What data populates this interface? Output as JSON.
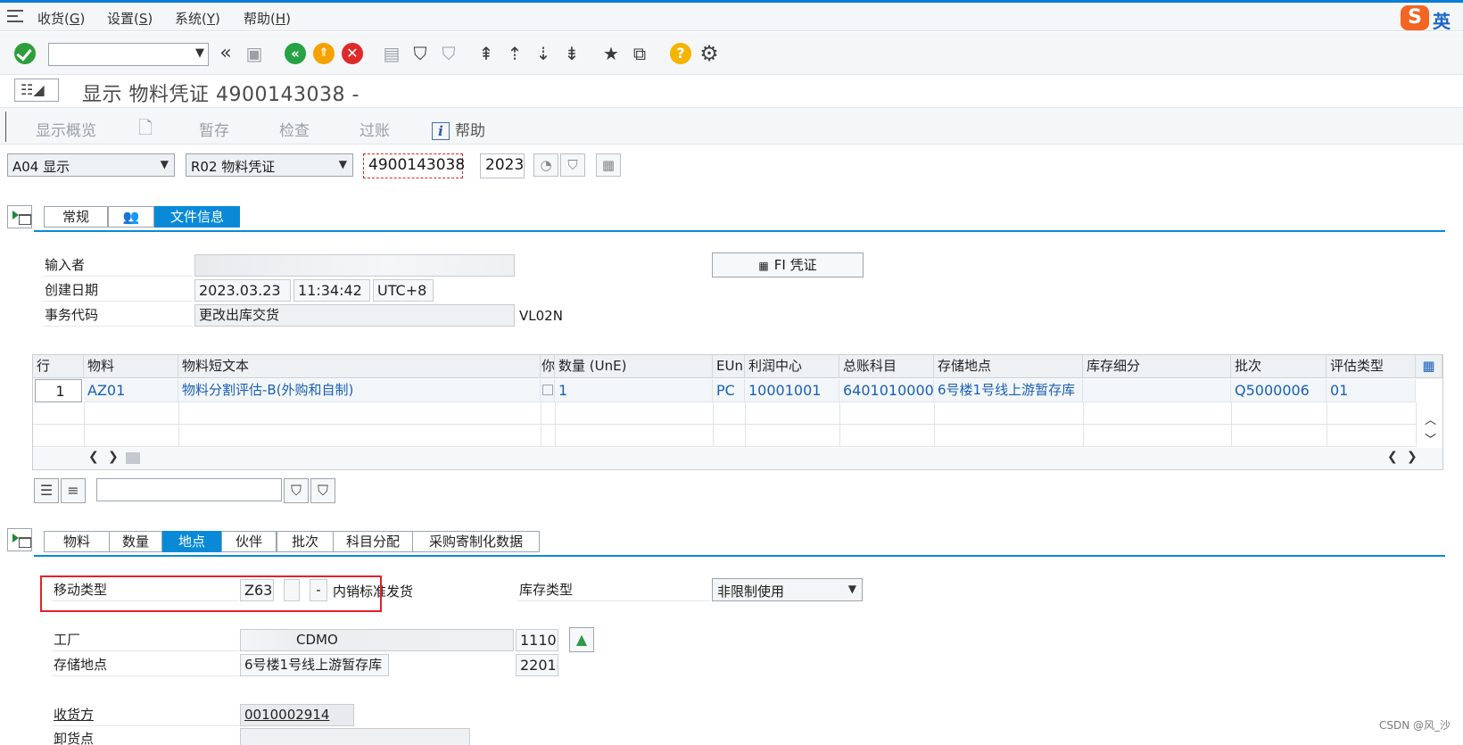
{
  "menu": {
    "items": [
      "收货(G)",
      "设置(S)",
      "系统(Y)",
      "帮助(H)"
    ],
    "underlines": [
      "G",
      "S",
      "Y",
      "H"
    ],
    "prefixes": [
      "收货(",
      "设置(",
      "系统(",
      "帮助("
    ]
  },
  "ime": {
    "logo": "S",
    "mode": "英"
  },
  "title": "显示 物料凭证 4900143038 -",
  "app_toolbar": {
    "overview": "显示概览",
    "hold": "暂存",
    "check": "检查",
    "post": "过账",
    "help": "帮助"
  },
  "selection": {
    "action": "A04 显示",
    "ref_doc": "R02 物料凭证",
    "doc_number": "4900143038",
    "year": "2023"
  },
  "header_tabs": {
    "general": "常规",
    "doc_info": "文件信息"
  },
  "doc_info": {
    "entered_by_label": "输入者",
    "created_label": "创建日期",
    "created_date": "2023.03.23",
    "created_time": "11:34:42",
    "timezone": "UTC+8",
    "tcode_label": "事务代码",
    "tcode_text": "更改出库交货",
    "tcode": "VL02N",
    "fi_button": "FI 凭证"
  },
  "grid": {
    "headers": [
      "行",
      "物料",
      "物料短文本",
      "你",
      "数量 (UnE)",
      "EUn",
      "利润中心",
      "总账科目",
      "存储地点",
      "库存细分",
      "批次",
      "评估类型"
    ],
    "row": {
      "line": "1",
      "material": "AZ01",
      "short_text": "物料分割评估-B(外购和自制)",
      "qty": "1",
      "unit": "PC",
      "profit_center": "10001001",
      "gl_account": "6401010000",
      "storage_loc": "6号楼1号线上游暂存库",
      "stock_segment": "",
      "batch": "Q5000006",
      "valuation_type": "01"
    }
  },
  "item_tabs": [
    "物料",
    "数量",
    "地点",
    "伙伴",
    "批次",
    "科目分配",
    "采购寄制化数据"
  ],
  "item_detail": {
    "movement_type_label": "移动类型",
    "movement_type": "Z63",
    "sign": "-",
    "movement_type_text": "内销标准发货",
    "stock_type_label": "库存类型",
    "stock_type": "非限制使用",
    "plant_label": "工厂",
    "plant_name": "CDMO",
    "plant_code": "1110",
    "sloc_label": "存储地点",
    "sloc_name": "6号楼1号线上游暂存库",
    "sloc_code": "2201",
    "receiver_label": "收货方",
    "receiver": "0010002914",
    "unload_label": "卸货点"
  },
  "watermark": "CSDN @风_沙",
  "colors": {
    "accent": "#0a8ad6",
    "highlight": "#e5202a"
  }
}
